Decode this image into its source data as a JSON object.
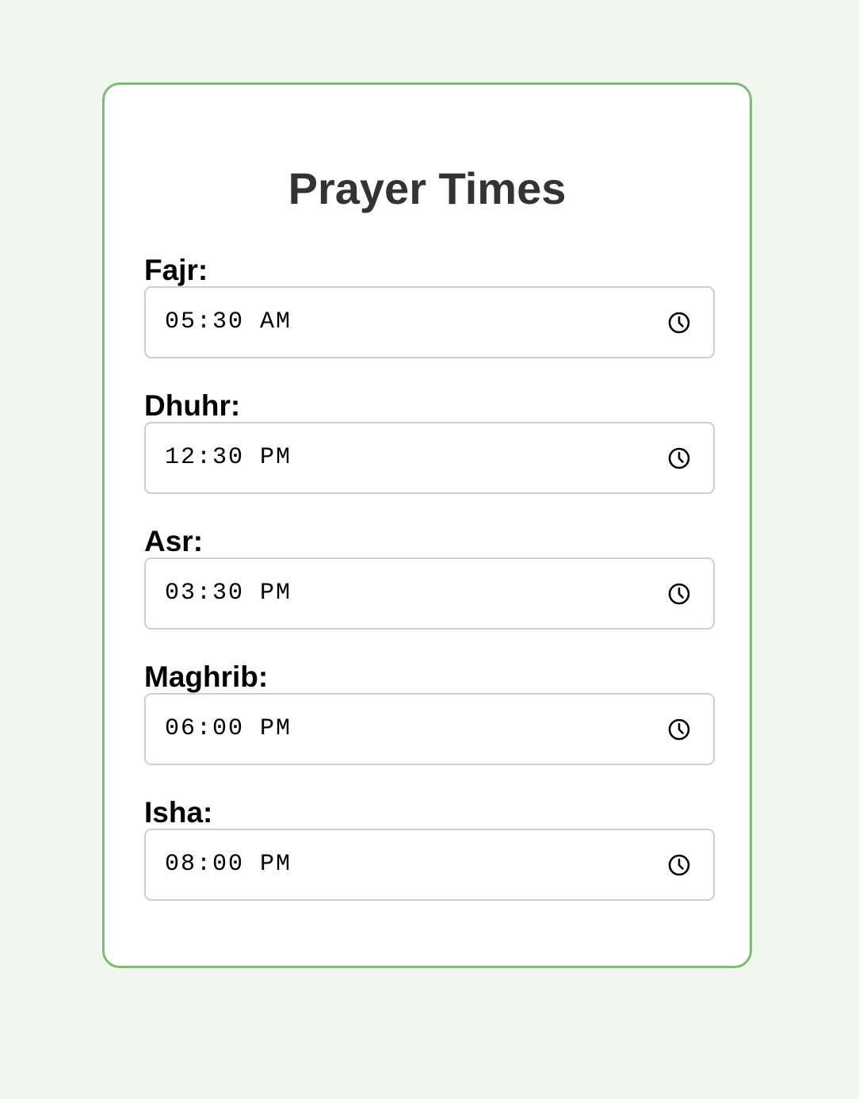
{
  "page": {
    "title": "Prayer Times"
  },
  "prayers": [
    {
      "label": "Fajr:",
      "value": "05:30 AM",
      "icon": "clock-icon"
    },
    {
      "label": "Dhuhr:",
      "value": "12:30 PM",
      "icon": "clock-icon"
    },
    {
      "label": "Asr:",
      "value": "03:30 PM",
      "icon": "clock-icon"
    },
    {
      "label": "Maghrib:",
      "value": "06:00 PM",
      "icon": "clock-icon"
    },
    {
      "label": "Isha:",
      "value": "08:00 PM",
      "icon": "clock-icon"
    }
  ],
  "colors": {
    "background": "#f1f7ec",
    "card_border": "#7fba78",
    "title": "#333333",
    "input_border": "#cfcfcf"
  }
}
